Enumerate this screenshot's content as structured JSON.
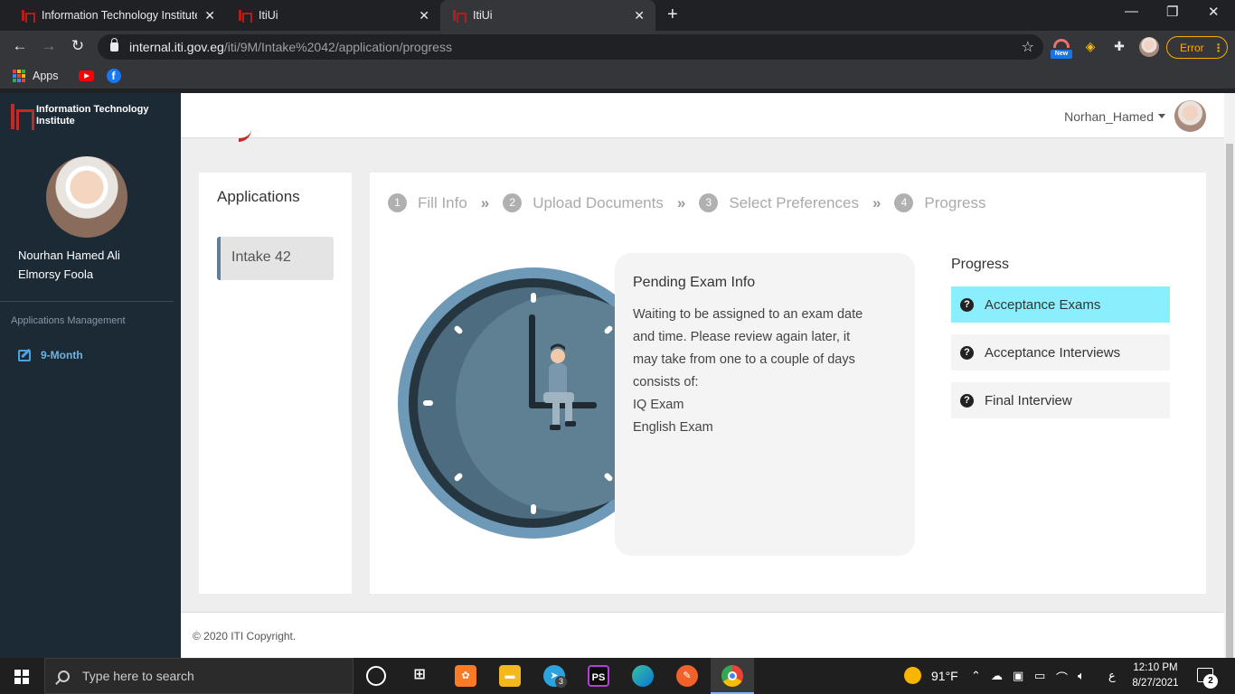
{
  "browser": {
    "tabs": [
      {
        "title": "Information Technology Institute",
        "close": "✕"
      },
      {
        "title": "ItiUi",
        "close": "✕"
      },
      {
        "title": "ItiUi",
        "close": "✕"
      }
    ],
    "new_tab": "+",
    "window_controls": {
      "minimize": "—",
      "restore": "❐",
      "close": "✕"
    },
    "url_host": "internal.iti.gov.eg",
    "url_path": "/iti/9M/Intake%2042/application/progress",
    "error_label": "Error",
    "bookmarks": {
      "apps_label": "Apps"
    },
    "ext_new_badge": "New"
  },
  "sidebar": {
    "brand_name": "Information Technology Institute",
    "profile_name_line1": "Nourhan Hamed Ali",
    "profile_name_line2": "Elmorsy Foola",
    "section_title": "Applications Management",
    "link_label": "9-Month"
  },
  "header": {
    "username": "Norhan_Hamed"
  },
  "applications": {
    "title": "Applications",
    "items": [
      {
        "label": "Intake 42"
      }
    ]
  },
  "steps": [
    {
      "num": "1",
      "label": "Fill Info"
    },
    {
      "num": "2",
      "label": "Upload Documents"
    },
    {
      "num": "3",
      "label": "Select Preferences"
    },
    {
      "num": "4",
      "label": "Progress"
    }
  ],
  "step_separator": "»",
  "info_card": {
    "title": "Pending Exam Info",
    "body_line1": "Waiting to be assigned to an exam date",
    "body_line2": "and time. Please review again later, it",
    "body_line3": "may take from one to a couple of days",
    "body_line4": "consists of:",
    "body_line5": "IQ Exam",
    "body_line6": "English Exam"
  },
  "progress": {
    "title": "Progress",
    "items": [
      {
        "label": "Acceptance Exams",
        "active": true
      },
      {
        "label": "Acceptance Interviews",
        "active": false
      },
      {
        "label": "Final Interview",
        "active": false
      }
    ],
    "icon_glyph": "?"
  },
  "footer": {
    "copyright": "© 2020 ITI Copyright."
  },
  "taskbar": {
    "search_placeholder": "Type here to search",
    "weather": "91°F",
    "lang": "ع",
    "time": "12:10 PM",
    "date": "8/27/2021",
    "telegram_badge": "3",
    "notif_count": "2",
    "ps_label": "PS"
  },
  "colors": {
    "sidebar_bg": "#1c2a36",
    "accent_red": "#c62828",
    "progress_active": "#8aeefc",
    "link_blue": "#6fb3e0"
  }
}
